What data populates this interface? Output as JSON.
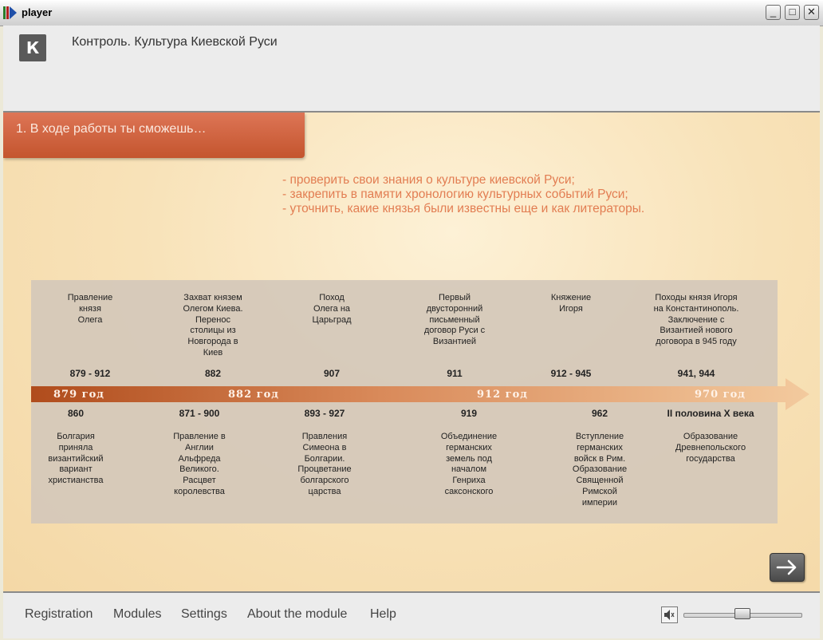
{
  "window": {
    "title": "player",
    "minimize_label": "_",
    "maximize_label": "□",
    "close_label": "✕"
  },
  "header": {
    "logo_text": "К",
    "title": "Контроль. Культура Киевской Руси"
  },
  "section": {
    "title": "1. В ходе работы ты сможешь…"
  },
  "goals": [
    "- проверить свои знания о культуре киевской Руси;",
    "- закрепить в памяти хронологию культурных событий Руси;",
    "- уточнить, какие князья были известны еще и как литераторы."
  ],
  "timeline": {
    "top_events": [
      {
        "lines": [
          "Правление",
          "князя",
          "Олега"
        ],
        "date": "879 - 912"
      },
      {
        "lines": [
          "Захват князем",
          "Олегом Киева.",
          "Перенос",
          "столицы из",
          "Новгорода в",
          "Киев"
        ],
        "date": "882"
      },
      {
        "lines": [
          "Поход",
          "Олега на",
          "Царьград"
        ],
        "date": "907"
      },
      {
        "lines": [
          "Первый",
          "двусторонний",
          "письменный",
          "договор Руси с",
          "Византией"
        ],
        "date": "911"
      },
      {
        "lines": [
          "Княжение",
          "Игоря"
        ],
        "date": "912 - 945"
      },
      {
        "lines": [
          "Походы князя Игоря",
          "на Константинополь.",
          "Заключение с",
          "Византией нового",
          "договора в 945 году"
        ],
        "date": "941, 944"
      }
    ],
    "arrow_labels": [
      "879 год",
      "882 год",
      "912 год",
      "970 год"
    ],
    "bottom_events": [
      {
        "date": "860",
        "lines": [
          "Болгария",
          "приняла",
          "византийский",
          "вариант",
          "христианства"
        ]
      },
      {
        "date": "871 - 900",
        "lines": [
          "Правление в",
          "Англии",
          "Альфреда",
          "Великого.",
          "Расцвет",
          "королевства"
        ]
      },
      {
        "date": "893 - 927",
        "lines": [
          "Правления",
          "Симеона в",
          "Болгарии.",
          "Процветание",
          "болгарского",
          "царства"
        ]
      },
      {
        "date": "919",
        "lines": [
          "Объединение",
          "германских",
          "земель под",
          "началом",
          "Генриха",
          "саксонского"
        ]
      },
      {
        "date": "962",
        "lines": [
          "Вступление",
          "германских",
          "войск в Рим.",
          "Образование",
          "Священной",
          "Римской",
          "империи"
        ]
      },
      {
        "date": "II половина X века",
        "lines": [
          "Образование",
          "Древнепольского",
          "государства"
        ]
      }
    ]
  },
  "footer": {
    "nav": [
      "Registration",
      "Modules",
      "Settings",
      "About the module",
      "Help"
    ],
    "volume": 0.5
  },
  "colors": {
    "banner": "#cf623c",
    "goals_text": "#e27d52",
    "arrow_start": "#b4501f",
    "arrow_end": "#f3c99c"
  },
  "icons": {
    "app": "player-app-icon",
    "next": "arrow-right-icon",
    "sound": "speaker-icon"
  }
}
